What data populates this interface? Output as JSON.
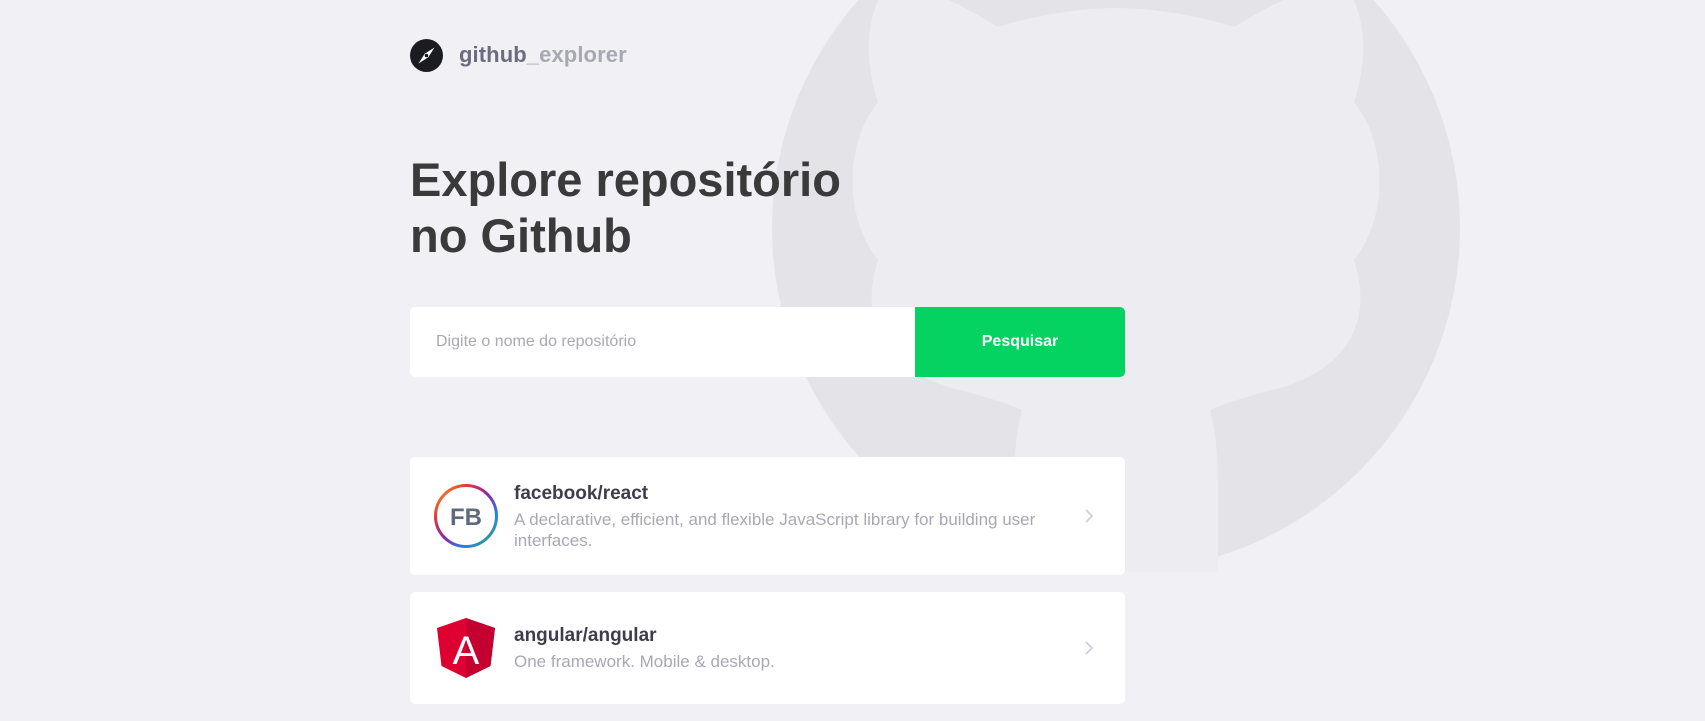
{
  "app": {
    "logo_icon": "compass-icon",
    "brand_primary": "github",
    "brand_secondary": "_explorer"
  },
  "hero": {
    "title_line1": "Explore repositório",
    "title_line2": "no Github"
  },
  "search": {
    "placeholder": "Digite o nome do repositório",
    "value": "",
    "button_label": "Pesquisar"
  },
  "repositories": [
    {
      "full_name": "facebook/react",
      "description": "A declarative, efficient, and flexible JavaScript library for building user interfaces.",
      "avatar_icon": "facebook-avatar-icon",
      "avatar_text": "FB"
    },
    {
      "full_name": "angular/angular",
      "description": "One framework. Mobile & desktop.",
      "avatar_icon": "angular-avatar-icon",
      "avatar_text": "A"
    }
  ],
  "colors": {
    "background": "#f0f0f5",
    "accent": "#04d361",
    "title": "#3a3a3a",
    "muted": "#a8a8b3"
  }
}
